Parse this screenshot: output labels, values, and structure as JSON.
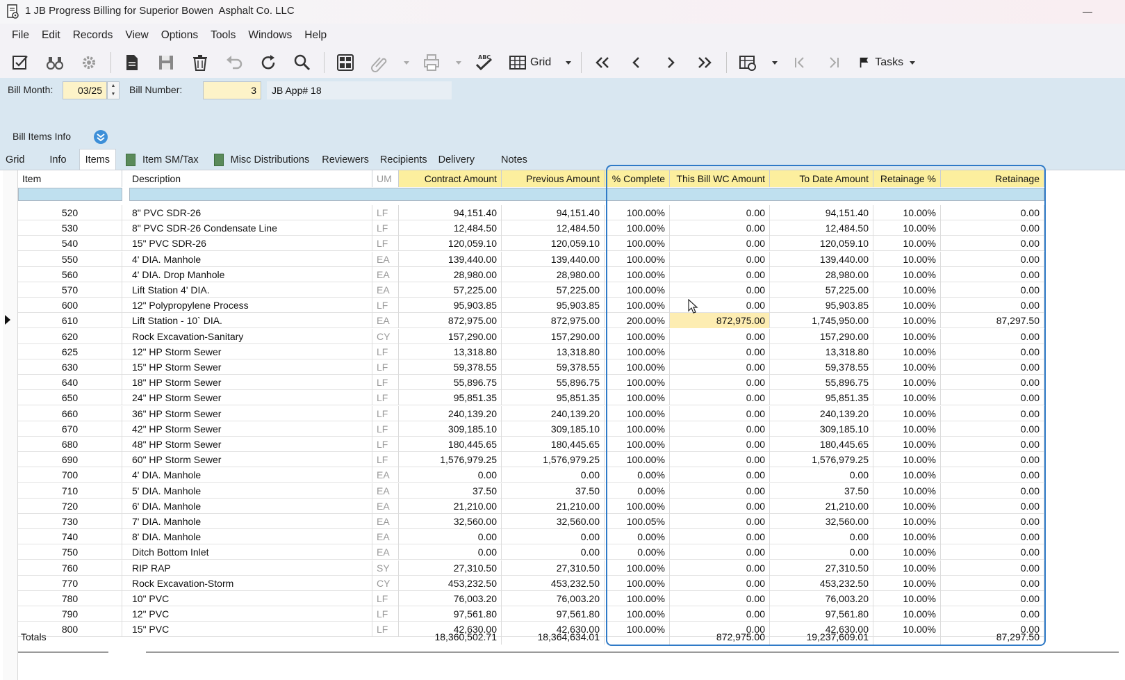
{
  "window": {
    "title": "1 JB Progress Billing for Superior Bowen  Asphalt Co. LLC",
    "icon": "document-gear-icon"
  },
  "menu": [
    "File",
    "Edit",
    "Records",
    "View",
    "Options",
    "Tools",
    "Windows",
    "Help"
  ],
  "toolbar": {
    "grid_label": "Grid",
    "tasks_label": "Tasks"
  },
  "form": {
    "bill_month_label": "Bill Month:",
    "bill_month_value": "03/25",
    "bill_number_label": "Bill Number:",
    "bill_number_value": "3",
    "jb_app_value": "JB App# 18",
    "section_label": "Bill Items Info"
  },
  "tabs": [
    "Grid",
    "Info",
    "Items",
    "Item SM/Tax",
    "Misc Distributions",
    "Reviewers",
    "Recipients",
    "Delivery",
    "Notes"
  ],
  "active_tab": "Items",
  "columns": {
    "item": "Item",
    "description": "Description",
    "um": "UM",
    "contract": "Contract Amount",
    "previous": "Previous Amount",
    "pct": "% Complete",
    "this_bill": "This Bill WC Amount",
    "to_date": "To Date Amount",
    "ret_pct": "Retainage %",
    "retainage": "Retainage"
  },
  "rows": [
    {
      "item": "520",
      "desc": "8\" PVC SDR-26",
      "um": "LF",
      "contract": "94,151.40",
      "previous": "94,151.40",
      "pct": "100.00%",
      "this_bill": "0.00",
      "to_date": "94,151.40",
      "ret_pct": "10.00%",
      "retainage": "0.00"
    },
    {
      "item": "530",
      "desc": "8\" PVC SDR-26 Condensate Line",
      "um": "LF",
      "contract": "12,484.50",
      "previous": "12,484.50",
      "pct": "100.00%",
      "this_bill": "0.00",
      "to_date": "12,484.50",
      "ret_pct": "10.00%",
      "retainage": "0.00"
    },
    {
      "item": "540",
      "desc": "15\" PVC SDR-26",
      "um": "LF",
      "contract": "120,059.10",
      "previous": "120,059.10",
      "pct": "100.00%",
      "this_bill": "0.00",
      "to_date": "120,059.10",
      "ret_pct": "10.00%",
      "retainage": "0.00"
    },
    {
      "item": "550",
      "desc": "4' DIA. Manhole",
      "um": "EA",
      "contract": "139,440.00",
      "previous": "139,440.00",
      "pct": "100.00%",
      "this_bill": "0.00",
      "to_date": "139,440.00",
      "ret_pct": "10.00%",
      "retainage": "0.00"
    },
    {
      "item": "560",
      "desc": "4' DIA. Drop Manhole",
      "um": "EA",
      "contract": "28,980.00",
      "previous": "28,980.00",
      "pct": "100.00%",
      "this_bill": "0.00",
      "to_date": "28,980.00",
      "ret_pct": "10.00%",
      "retainage": "0.00"
    },
    {
      "item": "570",
      "desc": "Lift Station 4' DIA.",
      "um": "EA",
      "contract": "57,225.00",
      "previous": "57,225.00",
      "pct": "100.00%",
      "this_bill": "0.00",
      "to_date": "57,225.00",
      "ret_pct": "10.00%",
      "retainage": "0.00"
    },
    {
      "item": "600",
      "desc": "12\" Polypropylene Process",
      "um": "LF",
      "contract": "95,903.85",
      "previous": "95,903.85",
      "pct": "100.00%",
      "this_bill": "0.00",
      "to_date": "95,903.85",
      "ret_pct": "10.00%",
      "retainage": "0.00"
    },
    {
      "item": "610",
      "desc": "Lift Station - 10` DIA.",
      "um": "EA",
      "contract": "872,975.00",
      "previous": "872,975.00",
      "pct": "200.00%",
      "this_bill": "872,975.00",
      "to_date": "1,745,950.00",
      "ret_pct": "10.00%",
      "retainage": "87,297.50"
    },
    {
      "item": "620",
      "desc": "Rock Excavation-Sanitary",
      "um": "CY",
      "contract": "157,290.00",
      "previous": "157,290.00",
      "pct": "100.00%",
      "this_bill": "0.00",
      "to_date": "157,290.00",
      "ret_pct": "10.00%",
      "retainage": "0.00"
    },
    {
      "item": "625",
      "desc": "12\" HP Storm Sewer",
      "um": "LF",
      "contract": "13,318.80",
      "previous": "13,318.80",
      "pct": "100.00%",
      "this_bill": "0.00",
      "to_date": "13,318.80",
      "ret_pct": "10.00%",
      "retainage": "0.00"
    },
    {
      "item": "630",
      "desc": "15\" HP Storm Sewer",
      "um": "LF",
      "contract": "59,378.55",
      "previous": "59,378.55",
      "pct": "100.00%",
      "this_bill": "0.00",
      "to_date": "59,378.55",
      "ret_pct": "10.00%",
      "retainage": "0.00"
    },
    {
      "item": "640",
      "desc": "18\" HP Storm Sewer",
      "um": "LF",
      "contract": "55,896.75",
      "previous": "55,896.75",
      "pct": "100.00%",
      "this_bill": "0.00",
      "to_date": "55,896.75",
      "ret_pct": "10.00%",
      "retainage": "0.00"
    },
    {
      "item": "650",
      "desc": "24\" HP Storm Sewer",
      "um": "LF",
      "contract": "95,851.35",
      "previous": "95,851.35",
      "pct": "100.00%",
      "this_bill": "0.00",
      "to_date": "95,851.35",
      "ret_pct": "10.00%",
      "retainage": "0.00"
    },
    {
      "item": "660",
      "desc": "36\" HP Storm Sewer",
      "um": "LF",
      "contract": "240,139.20",
      "previous": "240,139.20",
      "pct": "100.00%",
      "this_bill": "0.00",
      "to_date": "240,139.20",
      "ret_pct": "10.00%",
      "retainage": "0.00"
    },
    {
      "item": "670",
      "desc": "42\" HP Storm Sewer",
      "um": "LF",
      "contract": "309,185.10",
      "previous": "309,185.10",
      "pct": "100.00%",
      "this_bill": "0.00",
      "to_date": "309,185.10",
      "ret_pct": "10.00%",
      "retainage": "0.00"
    },
    {
      "item": "680",
      "desc": "48\" HP Storm Sewer",
      "um": "LF",
      "contract": "180,445.65",
      "previous": "180,445.65",
      "pct": "100.00%",
      "this_bill": "0.00",
      "to_date": "180,445.65",
      "ret_pct": "10.00%",
      "retainage": "0.00"
    },
    {
      "item": "690",
      "desc": "60\" HP Storm Sewer",
      "um": "LF",
      "contract": "1,576,979.25",
      "previous": "1,576,979.25",
      "pct": "100.00%",
      "this_bill": "0.00",
      "to_date": "1,576,979.25",
      "ret_pct": "10.00%",
      "retainage": "0.00"
    },
    {
      "item": "700",
      "desc": "4' DIA. Manhole",
      "um": "EA",
      "contract": "0.00",
      "previous": "0.00",
      "pct": "0.00%",
      "this_bill": "0.00",
      "to_date": "0.00",
      "ret_pct": "10.00%",
      "retainage": "0.00"
    },
    {
      "item": "710",
      "desc": "5' DIA. Manhole",
      "um": "EA",
      "contract": "37.50",
      "previous": "37.50",
      "pct": "0.00%",
      "this_bill": "0.00",
      "to_date": "37.50",
      "ret_pct": "10.00%",
      "retainage": "0.00"
    },
    {
      "item": "720",
      "desc": "6' DIA. Manhole",
      "um": "EA",
      "contract": "21,210.00",
      "previous": "21,210.00",
      "pct": "100.00%",
      "this_bill": "0.00",
      "to_date": "21,210.00",
      "ret_pct": "10.00%",
      "retainage": "0.00"
    },
    {
      "item": "730",
      "desc": "7' DIA. Manhole",
      "um": "EA",
      "contract": "32,560.00",
      "previous": "32,560.00",
      "pct": "100.05%",
      "this_bill": "0.00",
      "to_date": "32,560.00",
      "ret_pct": "10.00%",
      "retainage": "0.00"
    },
    {
      "item": "740",
      "desc": "8' DIA. Manhole",
      "um": "EA",
      "contract": "0.00",
      "previous": "0.00",
      "pct": "0.00%",
      "this_bill": "0.00",
      "to_date": "0.00",
      "ret_pct": "10.00%",
      "retainage": "0.00"
    },
    {
      "item": "750",
      "desc": "Ditch Bottom Inlet",
      "um": "EA",
      "contract": "0.00",
      "previous": "0.00",
      "pct": "0.00%",
      "this_bill": "0.00",
      "to_date": "0.00",
      "ret_pct": "10.00%",
      "retainage": "0.00"
    },
    {
      "item": "760",
      "desc": "RIP RAP",
      "um": "SY",
      "contract": "27,310.50",
      "previous": "27,310.50",
      "pct": "100.00%",
      "this_bill": "0.00",
      "to_date": "27,310.50",
      "ret_pct": "10.00%",
      "retainage": "0.00"
    },
    {
      "item": "770",
      "desc": "Rock Excavation-Storm",
      "um": "CY",
      "contract": "453,232.50",
      "previous": "453,232.50",
      "pct": "100.00%",
      "this_bill": "0.00",
      "to_date": "453,232.50",
      "ret_pct": "10.00%",
      "retainage": "0.00"
    },
    {
      "item": "780",
      "desc": "10\" PVC",
      "um": "LF",
      "contract": "76,003.20",
      "previous": "76,003.20",
      "pct": "100.00%",
      "this_bill": "0.00",
      "to_date": "76,003.20",
      "ret_pct": "10.00%",
      "retainage": "0.00"
    },
    {
      "item": "790",
      "desc": "12\" PVC",
      "um": "LF",
      "contract": "97,561.80",
      "previous": "97,561.80",
      "pct": "100.00%",
      "this_bill": "0.00",
      "to_date": "97,561.80",
      "ret_pct": "10.00%",
      "retainage": "0.00"
    },
    {
      "item": "800",
      "desc": "15\" PVC",
      "um": "LF",
      "contract": "42,630.00",
      "previous": "42,630.00",
      "pct": "100.00%",
      "this_bill": "0.00",
      "to_date": "42,630.00",
      "ret_pct": "10.00%",
      "retainage": "0.00"
    }
  ],
  "current_row_item": "610",
  "totals": {
    "label": "Totals",
    "contract": "18,360,502.71",
    "previous": "18,364,634.01",
    "this_bill": "872,975.00",
    "to_date": "19,237,609.01",
    "retainage": "87,297.50"
  },
  "colors": {
    "header_yellow": "#fcef9e",
    "form_blue": "#d9e7f1",
    "highlight_cell": "#fdedb2",
    "selection_outline": "#2f7ac7"
  }
}
